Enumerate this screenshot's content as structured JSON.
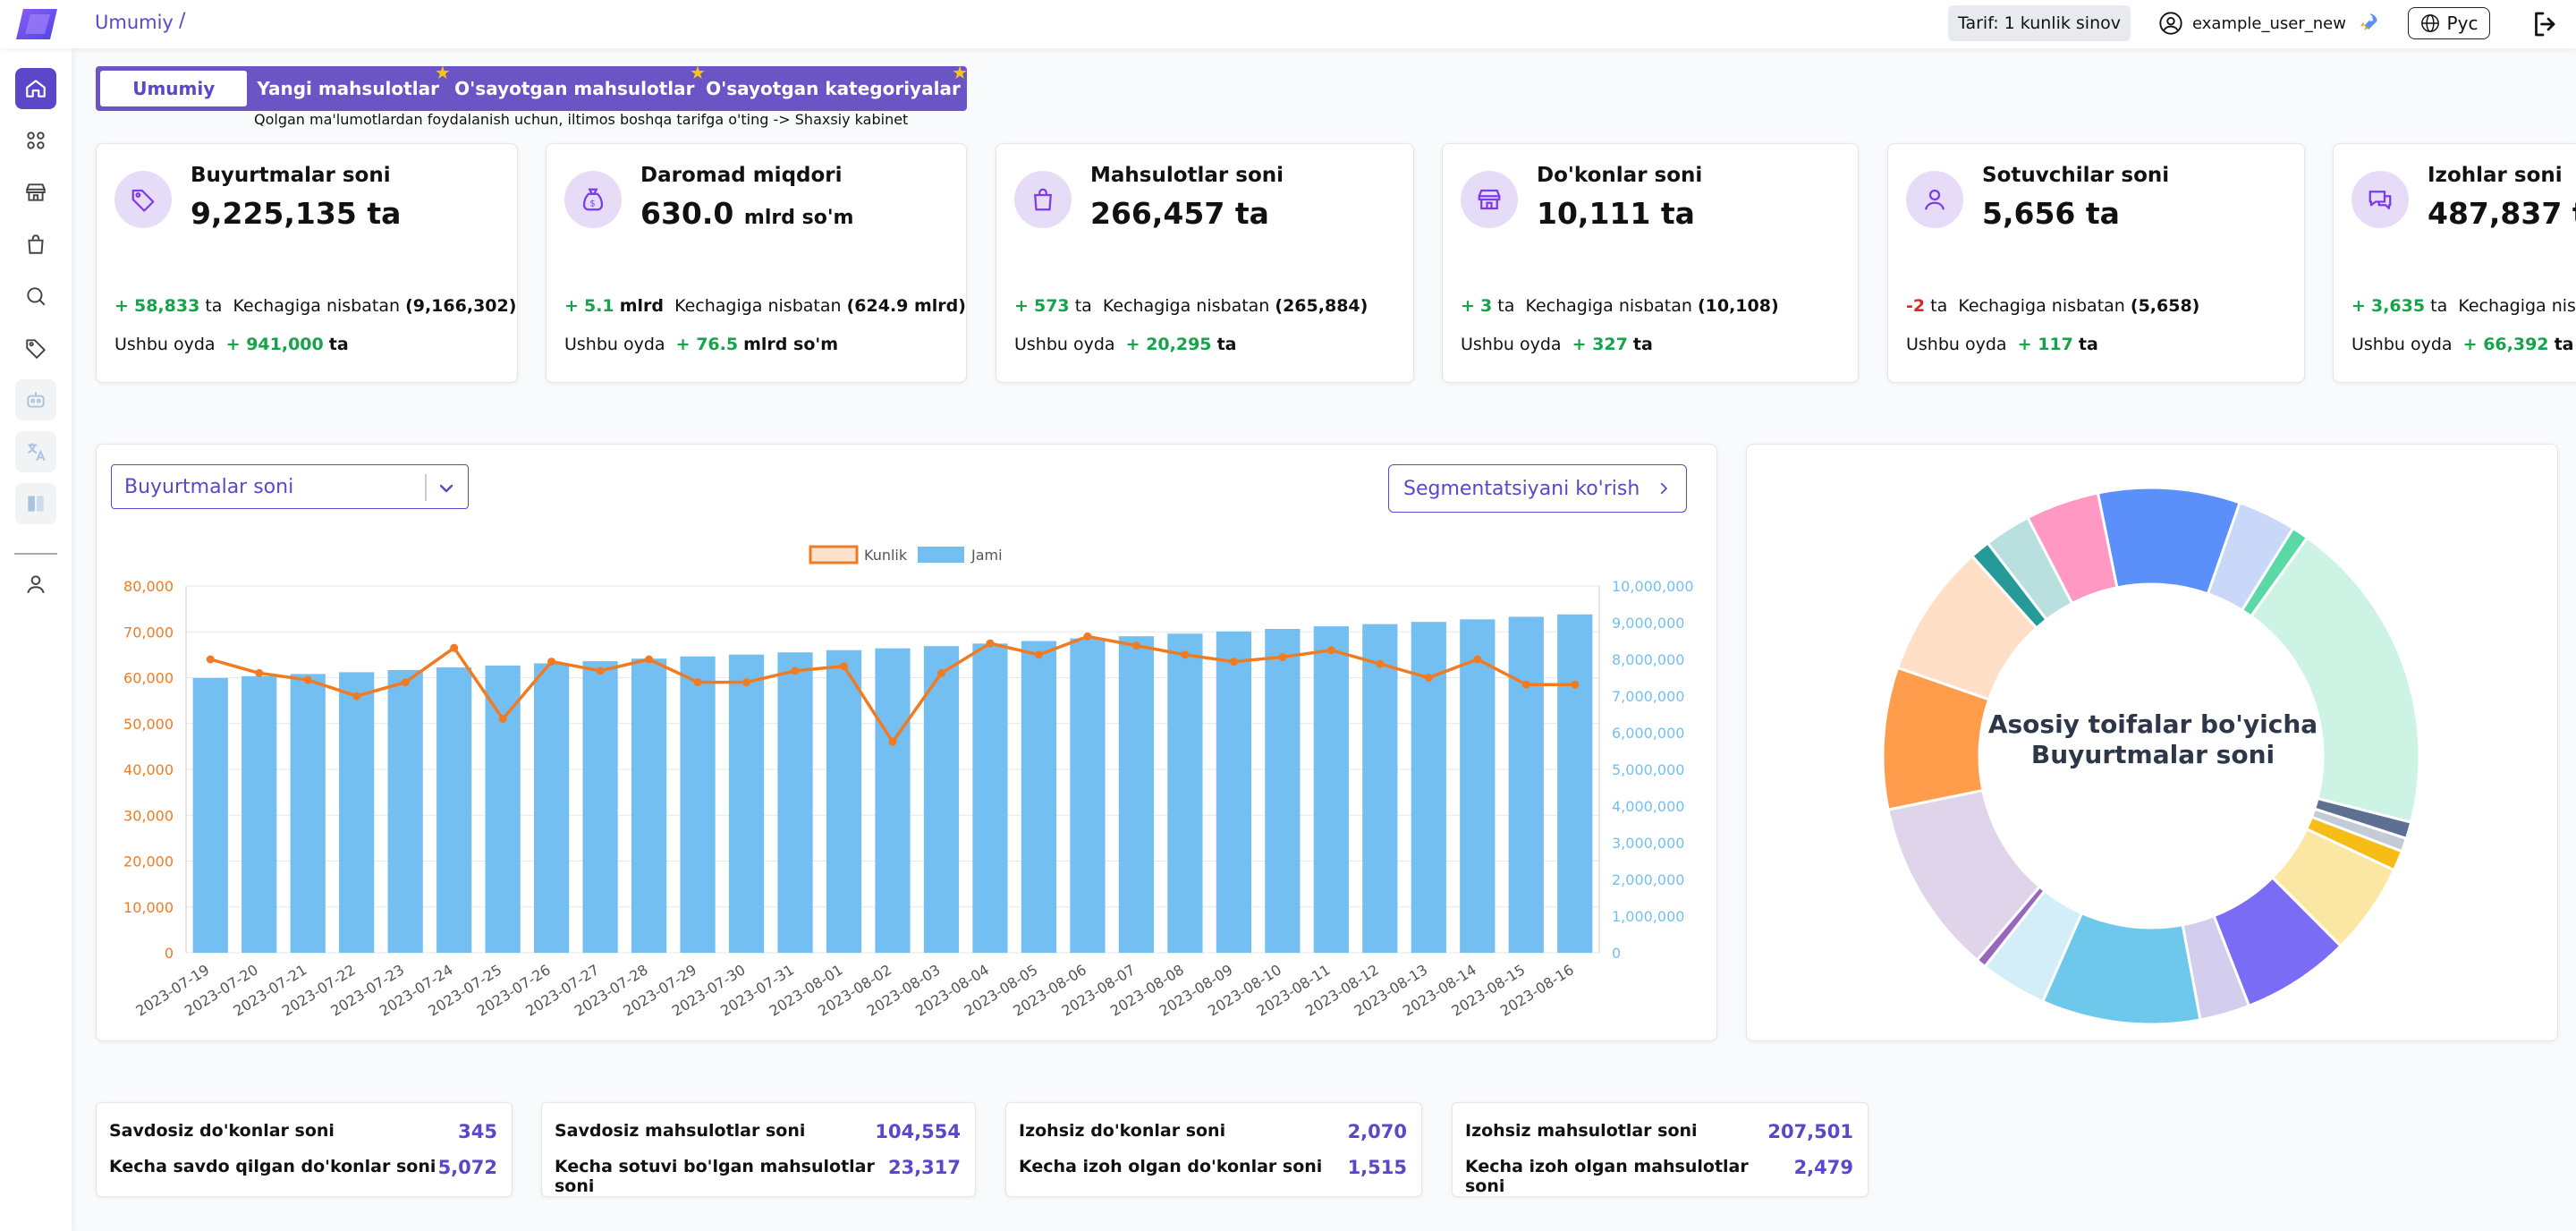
{
  "header": {
    "breadcrumb": "Umumiy",
    "breadcrumb_sep": "/",
    "tariff": "Tarif: 1 kunlik sinov",
    "username": "example_user_new",
    "language": "Рус"
  },
  "tabs": [
    {
      "label": "Umumiy"
    },
    {
      "label": "Yangi mahsulotlar"
    },
    {
      "label": "O'sayotgan mahsulotlar"
    },
    {
      "label": "O'sayotgan kategoriyalar"
    }
  ],
  "tab_note": "Qolgan ma'lumotlardan foydalanish uchun, iltimos boshqa tarifga o'ting -> Shaxsiy kabinet",
  "cards": [
    {
      "title": "Buyurtmalar soni",
      "value": "9,225,135",
      "unit": "ta",
      "delta_sign": "+",
      "delta": "58,833",
      "delta_unit": "ta",
      "compare_label": "Kechagiga nisbatan",
      "compare_value": "(9,166,302)",
      "month_label": "Ushbu oyda",
      "month_value": "+ 941,000",
      "month_unit": "ta",
      "icon": "tag-icon"
    },
    {
      "title": "Daromad miqdori",
      "value": "630.0",
      "unit": "mlrd so'm",
      "delta_sign": "+",
      "delta": "5.1",
      "delta_unit": "mlrd",
      "compare_label": "Kechagiga nisbatan",
      "compare_value": "(624.9 mlrd)",
      "month_label": "Ushbu oyda",
      "month_value": "+ 76.5",
      "month_unit": "mlrd so'm",
      "icon": "money-bag-icon"
    },
    {
      "title": "Mahsulotlar soni",
      "value": "266,457",
      "unit": "ta",
      "delta_sign": "+",
      "delta": "573",
      "delta_unit": "ta",
      "compare_label": "Kechagiga nisbatan",
      "compare_value": "(265,884)",
      "month_label": "Ushbu oyda",
      "month_value": "+ 20,295",
      "month_unit": "ta",
      "icon": "shopping-bag-icon"
    },
    {
      "title": "Do'konlar soni",
      "value": "10,111",
      "unit": "ta",
      "delta_sign": "+",
      "delta": "3",
      "delta_unit": "ta",
      "compare_label": "Kechagiga nisbatan",
      "compare_value": "(10,108)",
      "month_label": "Ushbu oyda",
      "month_value": "+ 327",
      "month_unit": "ta",
      "icon": "store-icon"
    },
    {
      "title": "Sotuvchilar soni",
      "value": "5,656",
      "unit": "ta",
      "delta_sign": "-",
      "delta": "2",
      "delta_unit": "ta",
      "compare_label": "Kechagiga nisbatan",
      "compare_value": "(5,658)",
      "month_label": "Ushbu oyda",
      "month_value": "+ 117",
      "month_unit": "ta",
      "icon": "user-icon"
    },
    {
      "title": "Izohlar soni",
      "value": "487,837",
      "unit": "ta",
      "delta_sign": "+",
      "delta": "3,635",
      "delta_unit": "ta",
      "compare_label": "Kechagiga nisbatan",
      "compare_value": "",
      "month_label": "Ushbu oyda",
      "month_value": "+ 66,392",
      "month_unit": "ta",
      "icon": "comments-icon"
    }
  ],
  "chart_panel": {
    "select_value": "Buyurtmalar soni",
    "segment_button": "Segmentatsiyani ko'rish"
  },
  "chart_data": {
    "type": "bar",
    "categories": [
      "2023-07-19",
      "2023-07-20",
      "2023-07-21",
      "2023-07-22",
      "2023-07-23",
      "2023-07-24",
      "2023-07-25",
      "2023-07-26",
      "2023-07-27",
      "2023-07-28",
      "2023-07-29",
      "2023-07-30",
      "2023-07-31",
      "2023-08-01",
      "2023-08-02",
      "2023-08-03",
      "2023-08-04",
      "2023-08-05",
      "2023-08-06",
      "2023-08-07",
      "2023-08-08",
      "2023-08-09",
      "2023-08-10",
      "2023-08-11",
      "2023-08-12",
      "2023-08-13",
      "2023-08-14",
      "2023-08-15",
      "2023-08-16"
    ],
    "series": [
      {
        "name": "Kunlik",
        "type": "line",
        "axis": "left",
        "color": "#f07b22",
        "values": [
          64000,
          61000,
          59500,
          56000,
          59000,
          66500,
          51000,
          63500,
          61500,
          64000,
          59000,
          59000,
          61500,
          62500,
          46000,
          61000,
          67500,
          65000,
          69000,
          67000,
          65000,
          63500,
          64500,
          66000,
          63000,
          60000,
          64000,
          58500,
          58500
        ]
      },
      {
        "name": "Jami",
        "type": "bar",
        "axis": "right",
        "color": "#74bff2",
        "values": [
          7490000,
          7540000,
          7600000,
          7650000,
          7710000,
          7780000,
          7830000,
          7890000,
          7950000,
          8020000,
          8080000,
          8130000,
          8190000,
          8250000,
          8300000,
          8360000,
          8430000,
          8500000,
          8570000,
          8630000,
          8700000,
          8760000,
          8830000,
          8900000,
          8960000,
          9020000,
          9090000,
          9160000,
          9225000
        ]
      }
    ],
    "ylim_left": [
      0,
      80000
    ],
    "yticks_left": [
      "0",
      "10,000",
      "20,000",
      "30,000",
      "40,000",
      "50,000",
      "60,000",
      "70,000",
      "80,000"
    ],
    "ylim_right": [
      0,
      10000000
    ],
    "yticks_right": [
      "0",
      "1,000,000",
      "2,000,000",
      "3,000,000",
      "4,000,000",
      "5,000,000",
      "6,000,000",
      "7,000,000",
      "8,000,000",
      "9,000,000",
      "10,000,000"
    ],
    "legend_position": "top-center",
    "grid": true
  },
  "donut": {
    "title_line1": "Asosiy toifalar bo'yicha",
    "title_line2": "Buyurtmalar soni",
    "chart_data": {
      "type": "pie",
      "values": [
        8.5,
        3.5,
        1.0,
        19.0,
        1.0,
        0.8,
        1.2,
        5.5,
        6.5,
        3.0,
        9.5,
        4.0,
        0.6,
        10.5,
        8.5,
        8.0,
        1.2,
        2.8,
        4.4
      ],
      "colors": [
        "#5b8ff9",
        "#c9d7f9",
        "#5ad8a6",
        "#cdf3e4",
        "#5d7092",
        "#c5cbd6",
        "#f6bd16",
        "#fce6a4",
        "#7b6cf6",
        "#d3ceee",
        "#6dc8ec",
        "#d3eef9",
        "#9867bc",
        "#e0d4eb",
        "#ff9d4d",
        "#ffe0c7",
        "#269a99",
        "#b9dfdf",
        "#ff99c3"
      ]
    }
  },
  "bottom_boxes": [
    {
      "row1_label": "Savdosiz do'konlar soni",
      "row1_value": "345",
      "row2_label": "Kecha savdo qilgan do'konlar soni",
      "row2_value": "5,072"
    },
    {
      "row1_label": "Savdosiz mahsulotlar soni",
      "row1_value": "104,554",
      "row2_label": "Kecha sotuvi bo'lgan mahsulotlar soni",
      "row2_value": "23,317"
    },
    {
      "row1_label": "Izohsiz do'konlar soni",
      "row1_value": "2,070",
      "row2_label": "Kecha izoh olgan do'konlar soni",
      "row2_value": "1,515"
    },
    {
      "row1_label": "Izohsiz mahsulotlar soni",
      "row1_value": "207,501",
      "row2_label": "Kecha izoh olgan mahsulotlar soni",
      "row2_value": "2,479"
    }
  ]
}
